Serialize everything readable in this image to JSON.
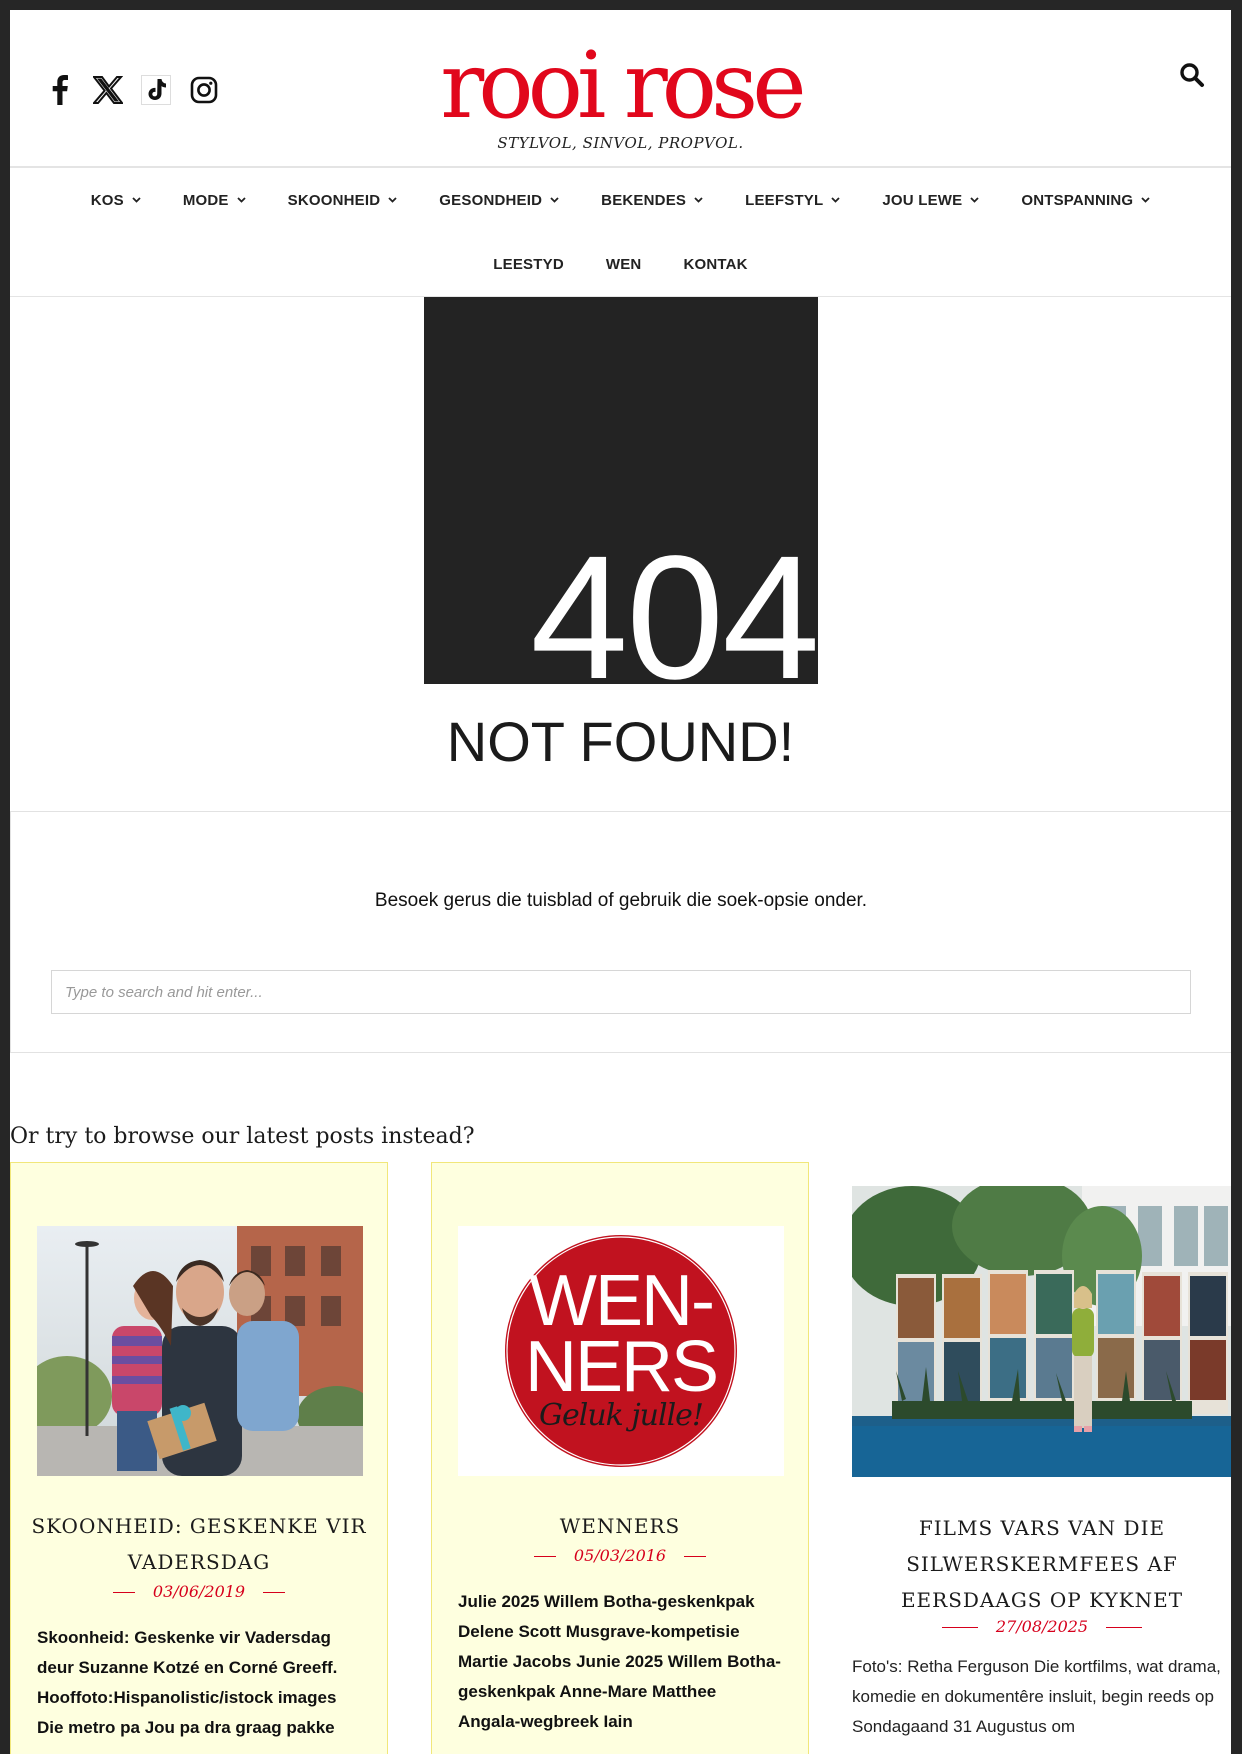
{
  "header": {
    "logo": "rooi rose",
    "tagline": "STYLVOL, SINVOL, PROPVOL.",
    "socials": [
      "facebook-icon",
      "x-icon",
      "tiktok-icon",
      "instagram-icon"
    ],
    "search_icon": "search-icon"
  },
  "nav": {
    "row1": [
      {
        "label": "KOS"
      },
      {
        "label": "MODE"
      },
      {
        "label": "SKOONHEID"
      },
      {
        "label": "GESONDHEID"
      },
      {
        "label": "BEKENDES"
      },
      {
        "label": "LEEFSTYL"
      },
      {
        "label": "JOU LEWE"
      },
      {
        "label": "ONTSPANNING"
      }
    ],
    "row2": [
      {
        "label": "LEESTYD"
      },
      {
        "label": "WEN"
      },
      {
        "label": "KONTAK"
      }
    ]
  },
  "error": {
    "code": "404",
    "title": "NOT FOUND!",
    "hint": "Besoek gerus die tuisblad of gebruik die soek-opsie onder.",
    "search_placeholder": "Type to search and hit enter..."
  },
  "latest": {
    "heading": "Or try to browse our latest posts instead?",
    "posts": [
      {
        "title": "SKOONHEID: GESKENKE VIR VADERSDAG",
        "date": "03/06/2019",
        "excerpt": "Skoonheid: Geskenke vir Vadersdag deur Suzanne Kotzé en Corné Greeff. Hooffoto:Hispanolistic/istock images   Die metro pa Jou pa dra graag pakke"
      },
      {
        "title": "WENNERS",
        "date": "05/03/2016",
        "image_text": {
          "line1": "WEN-",
          "line2": "NERS",
          "line3": "Geluk julle!"
        },
        "excerpt": "Julie 2025 Willem Botha-geskenkpak Delene Scott  Musgrave-kompetisie Martie Jacobs Junie 2025 Willem Botha-geskenkpak Anne-Mare Matthee  Angala-wegbreek Iain"
      },
      {
        "title": "FILMS VARS VAN DIE SILWERSKERMFEES AF EERSDAAGS OP KYKNET",
        "date": "27/08/2025",
        "excerpt": "Foto's: Retha Ferguson Die kortfilms, wat drama, komedie en dokumentêre insluit, begin reeds op Sondagaand 31 Augustus om"
      }
    ]
  },
  "colors": {
    "brand_red": "#e1071c",
    "date_red": "#d6001c",
    "card_highlight": "#feffdf",
    "dark_box": "#232323"
  }
}
